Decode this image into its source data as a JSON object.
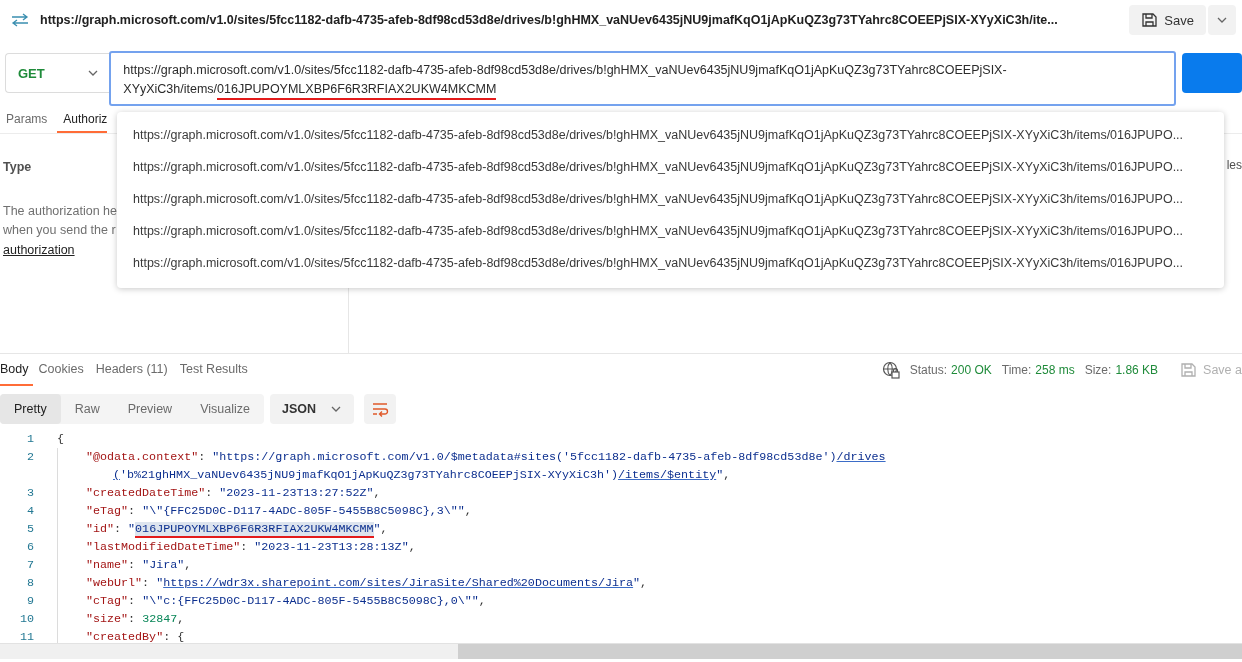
{
  "header": {
    "title": "https://graph.microsoft.com/v1.0/sites/5fcc1182-dafb-4735-afeb-8df98cd53d8e/drives/b!ghHMX_vaNUev6435jNU9jmafKqO1jApKuQZ3g73TYahrc8COEEPjSIX-XYyXiC3h/ite...",
    "save_label": "Save"
  },
  "request": {
    "method": "GET",
    "url_field": {
      "focused": true,
      "lines": [
        [
          {
            "text": "https://graph.microsoft.com/v1.0/sites/5fcc1182-dafb-4735-afeb-8df98cd53d8e/drives/b!ghHMX_vaNUev6435jNU9jmafKqO1jApKuQZ3g73TYahrc8COEEPjSIX-",
            "marked": false
          }
        ],
        [
          {
            "text": "XYyXiC3h/items/",
            "marked": false
          },
          {
            "text": "016JPUPOYMLXBP6F6R3RFIAX2UKW4MKCMM",
            "marked": true
          }
        ]
      ]
    }
  },
  "request_tabs": [
    {
      "label": "Params",
      "selected": false
    },
    {
      "label": "Authoriz",
      "selected": true
    }
  ],
  "auth_panel": {
    "type_label": "Type",
    "description_lines": [
      "The authorization he",
      "when you send the r"
    ],
    "link": "authorization",
    "right_fragment": "les"
  },
  "suggestions": [
    "https://graph.microsoft.com/v1.0/sites/5fcc1182-dafb-4735-afeb-8df98cd53d8e/drives/b!ghHMX_vaNUev6435jNU9jmafKqO1jApKuQZ3g73TYahrc8COEEPjSIX-XYyXiC3h/items/016JPUPO...",
    "https://graph.microsoft.com/v1.0/sites/5fcc1182-dafb-4735-afeb-8df98cd53d8e/drives/b!ghHMX_vaNUev6435jNU9jmafKqO1jApKuQZ3g73TYahrc8COEEPjSIX-XYyXiC3h/items/016JPUPO...",
    "https://graph.microsoft.com/v1.0/sites/5fcc1182-dafb-4735-afeb-8df98cd53d8e/drives/b!ghHMX_vaNUev6435jNU9jmafKqO1jApKuQZ3g73TYahrc8COEEPjSIX-XYyXiC3h/items/016JPUPO...",
    "https://graph.microsoft.com/v1.0/sites/5fcc1182-dafb-4735-afeb-8df98cd53d8e/drives/b!ghHMX_vaNUev6435jNU9jmafKqO1jApKuQZ3g73TYahrc8COEEPjSIX-XYyXiC3h/items/016JPUPO...",
    "https://graph.microsoft.com/v1.0/sites/5fcc1182-dafb-4735-afeb-8df98cd53d8e/drives/b!ghHMX_vaNUev6435jNU9jmafKqO1jApKuQZ3g73TYahrc8COEEPjSIX-XYyXiC3h/items/016JPUPO..."
  ],
  "response_tabs": [
    {
      "label": "Body",
      "selected": true
    },
    {
      "label": "Cookies",
      "selected": false
    },
    {
      "label": "Headers (11)",
      "selected": false
    },
    {
      "label": "Test Results",
      "selected": false
    }
  ],
  "response_status": [
    {
      "label": "Status:",
      "value": "200 OK"
    },
    {
      "label": "Time:",
      "value": "258 ms"
    },
    {
      "label": "Size:",
      "value": "1.86 KB"
    }
  ],
  "save_response_label": "Save a",
  "view_modes": [
    {
      "label": "Pretty",
      "selected": true
    },
    {
      "label": "Raw",
      "selected": false
    },
    {
      "label": "Preview",
      "selected": false
    },
    {
      "label": "Visualize",
      "selected": false
    }
  ],
  "format": "JSON",
  "code_lines": [
    {
      "number": "1",
      "tokens": [
        {
          "kind": "punct",
          "text": "{"
        }
      ],
      "children": [
        {
          "number": "2",
          "tokens": [
            {
              "kind": "key",
              "text": "\"@odata.context\""
            },
            {
              "kind": "punct",
              "text": ": "
            },
            {
              "kind": "string",
              "text": "\"https://graph.microsoft.com/v1.0/$metadata#sites('5fcc1182-dafb-4735-afeb-8df98cd53d8e')"
            },
            {
              "kind": "link",
              "text": "/drives"
            }
          ],
          "wrap_tokens": [
            {
              "kind": "link",
              "text": "("
            },
            {
              "kind": "string",
              "text": "'b%21ghHMX_vaNUev6435jNU9jmafKqO1jApKuQZ3g73TYahrc8COEEPjSIX-XYyXiC3h')"
            },
            {
              "kind": "link",
              "text": "/items/$entity"
            },
            {
              "kind": "string",
              "text": "\""
            },
            {
              "kind": "punct",
              "text": ","
            }
          ]
        },
        {
          "number": "3",
          "tokens": [
            {
              "kind": "key",
              "text": "\"createdDateTime\""
            },
            {
              "kind": "punct",
              "text": ": "
            },
            {
              "kind": "string",
              "text": "\"2023-11-23T13:27:52Z\""
            },
            {
              "kind": "punct",
              "text": ","
            }
          ]
        },
        {
          "number": "4",
          "tokens": [
            {
              "kind": "key",
              "text": "\"eTag\""
            },
            {
              "kind": "punct",
              "text": ": "
            },
            {
              "kind": "string",
              "text": "\"\\\"{FFC25D0C-D117-4ADC-805F-5455B8C5098C},3\\\"\""
            },
            {
              "kind": "punct",
              "text": ","
            }
          ]
        },
        {
          "number": "5",
          "tokens": [
            {
              "kind": "key",
              "text": "\"id\""
            },
            {
              "kind": "punct",
              "text": ": "
            },
            {
              "kind": "string",
              "text": "\""
            },
            {
              "kind": "selection",
              "text": "016JPUPOYMLXBP6F6R3RFIAX2UKW4MKCMM"
            },
            {
              "kind": "string",
              "text": "\""
            },
            {
              "kind": "punct",
              "text": ","
            }
          ]
        },
        {
          "number": "6",
          "tokens": [
            {
              "kind": "key",
              "text": "\"lastModifiedDateTime\""
            },
            {
              "kind": "punct",
              "text": ": "
            },
            {
              "kind": "string",
              "text": "\"2023-11-23T13:28:13Z\""
            },
            {
              "kind": "punct",
              "text": ","
            }
          ]
        },
        {
          "number": "7",
          "tokens": [
            {
              "kind": "key",
              "text": "\"name\""
            },
            {
              "kind": "punct",
              "text": ": "
            },
            {
              "kind": "string",
              "text": "\"Jira\""
            },
            {
              "kind": "punct",
              "text": ","
            }
          ]
        },
        {
          "number": "8",
          "tokens": [
            {
              "kind": "key",
              "text": "\"webUrl\""
            },
            {
              "kind": "punct",
              "text": ": "
            },
            {
              "kind": "string",
              "text": "\""
            },
            {
              "kind": "link",
              "text": "https://wdr3x.sharepoint.com/sites/JiraSite/Shared%20Documents/Jira"
            },
            {
              "kind": "string",
              "text": "\""
            },
            {
              "kind": "punct",
              "text": ","
            }
          ]
        },
        {
          "number": "9",
          "tokens": [
            {
              "kind": "key",
              "text": "\"cTag\""
            },
            {
              "kind": "punct",
              "text": ": "
            },
            {
              "kind": "string",
              "text": "\"\\\"c:{FFC25D0C-D117-4ADC-805F-5455B8C5098C},0\\\"\""
            },
            {
              "kind": "punct",
              "text": ","
            }
          ]
        },
        {
          "number": "10",
          "tokens": [
            {
              "kind": "key",
              "text": "\"size\""
            },
            {
              "kind": "punct",
              "text": ": "
            },
            {
              "kind": "number",
              "text": "32847"
            },
            {
              "kind": "punct",
              "text": ","
            }
          ]
        },
        {
          "number": "11",
          "tokens": [
            {
              "kind": "key",
              "text": "\"createdBy\""
            },
            {
              "kind": "punct",
              "text": ": {"
            }
          ]
        }
      ]
    }
  ]
}
